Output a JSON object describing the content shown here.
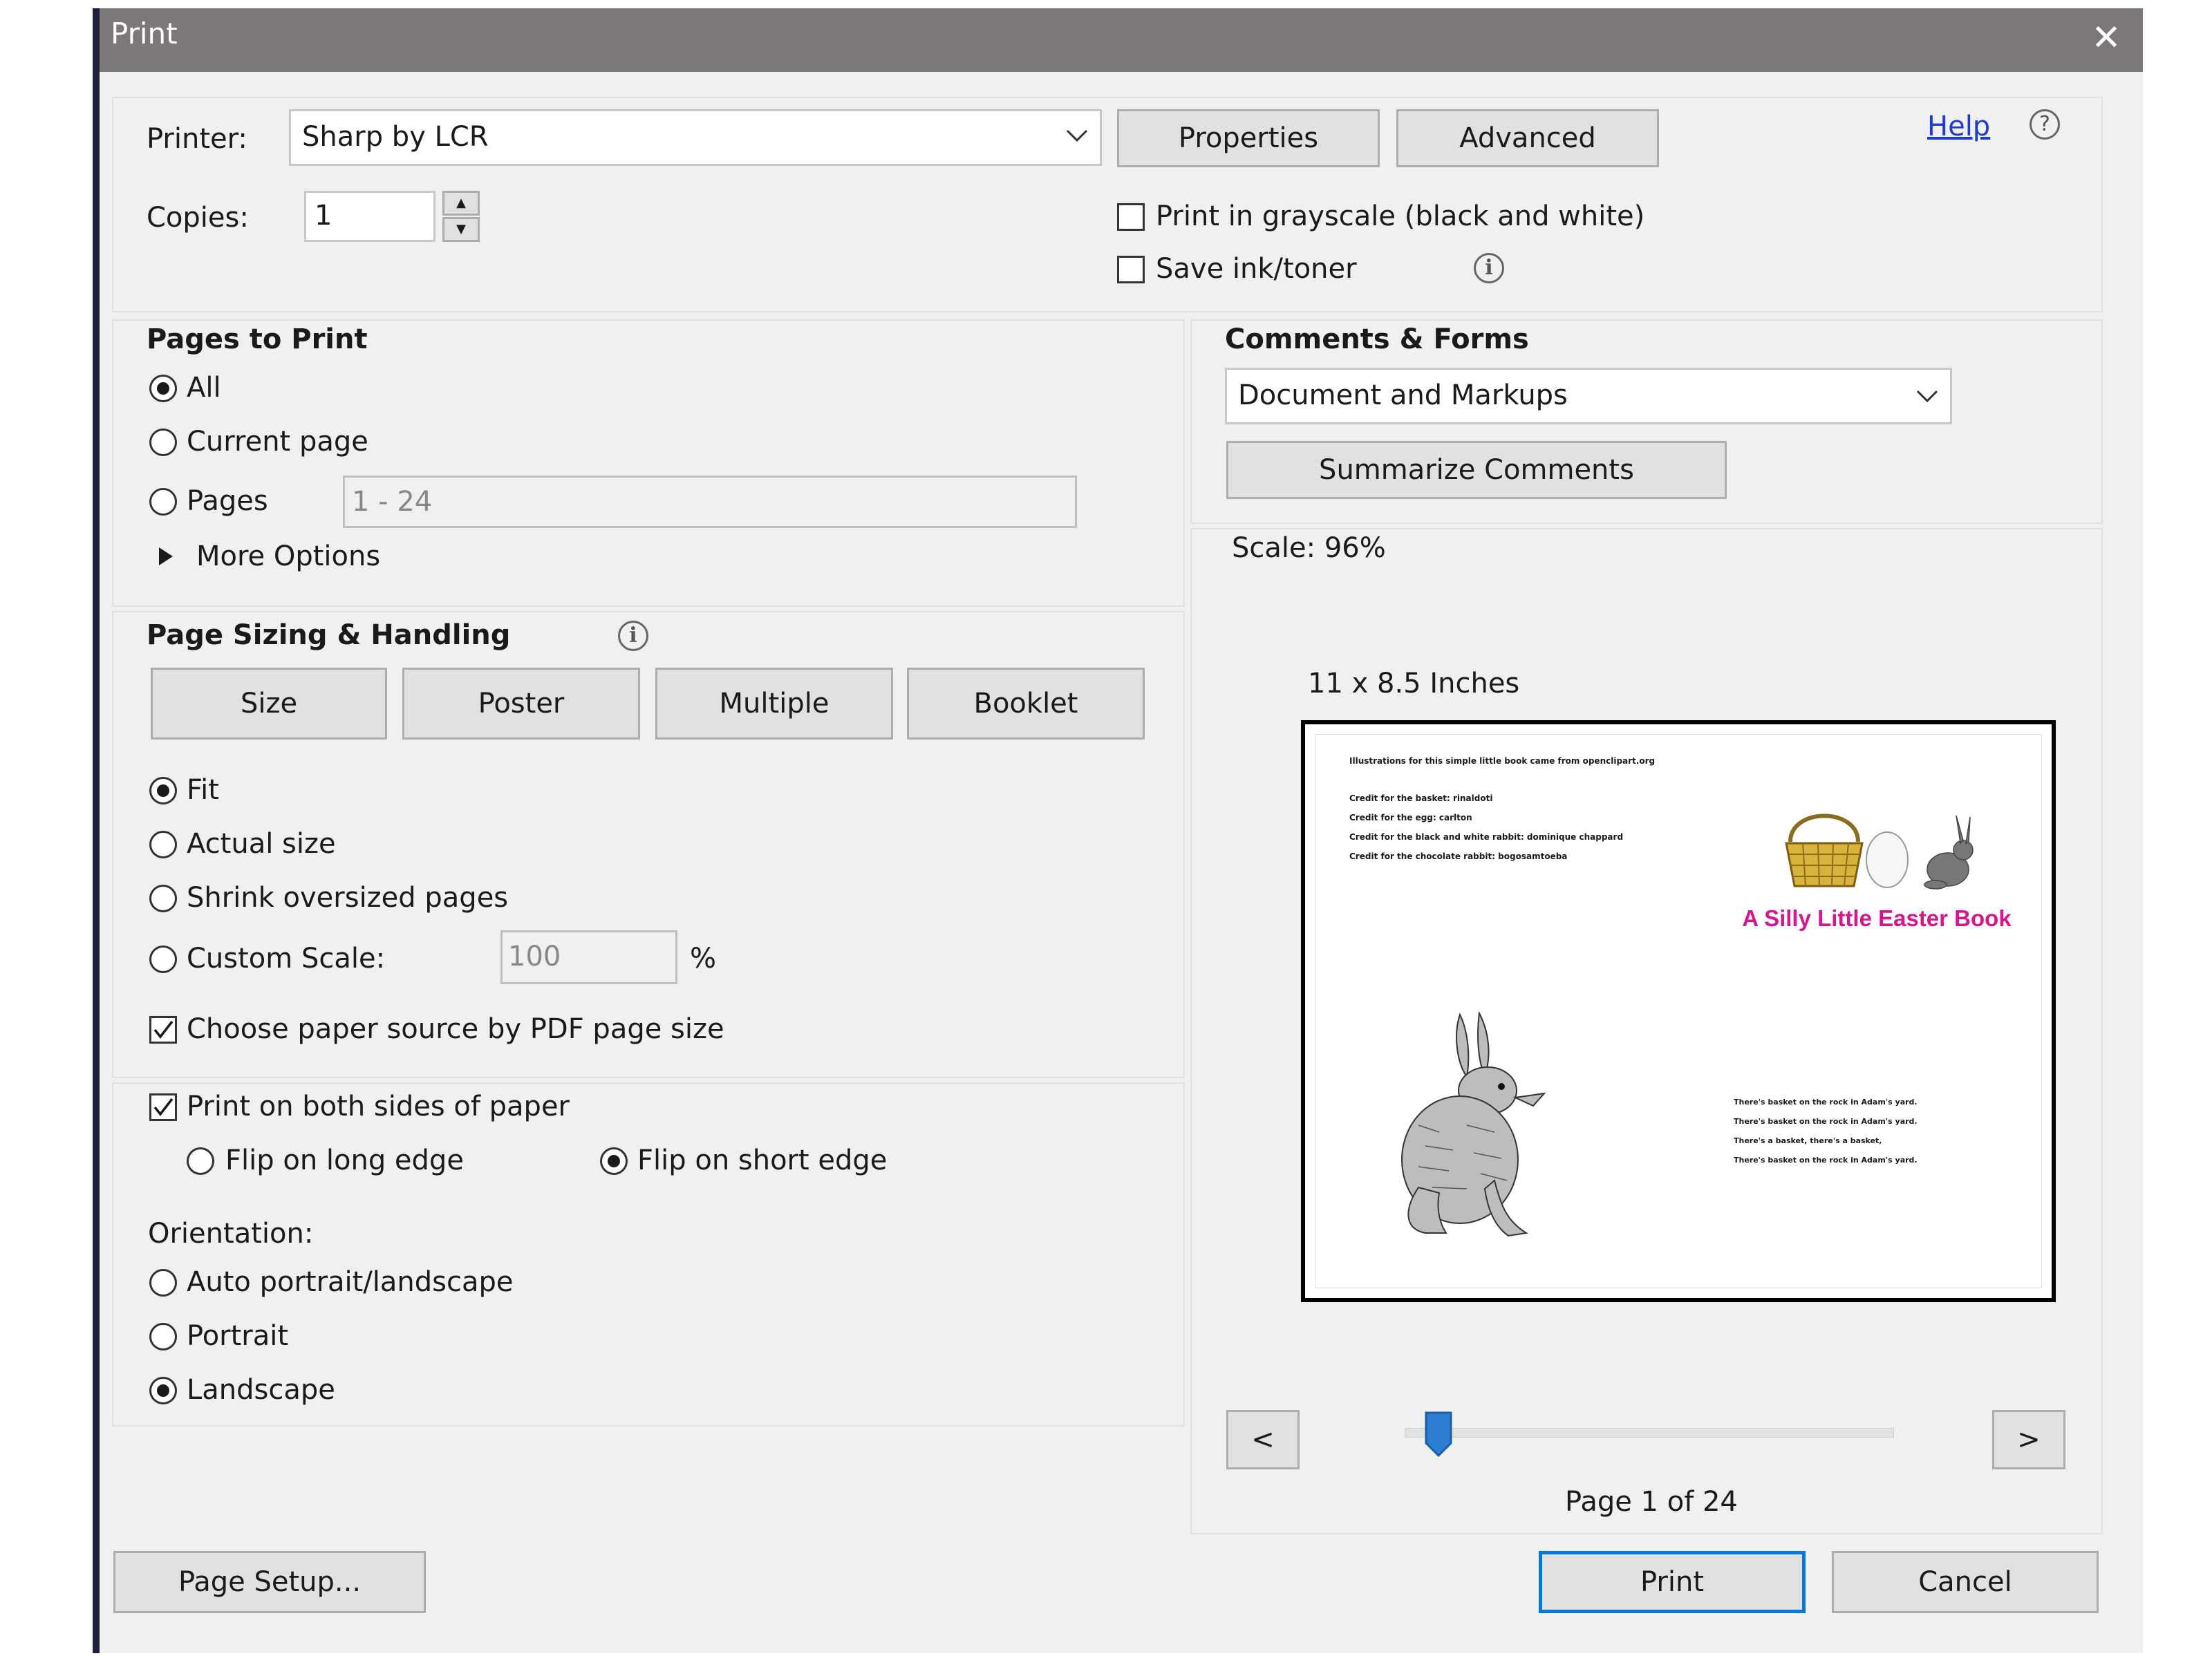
{
  "dialog": {
    "title": "Print",
    "close_label": "✕"
  },
  "printer": {
    "label": "Printer:",
    "selected": "Sharp by LCR",
    "properties": "Properties",
    "advanced": "Advanced",
    "help": "Help",
    "help_icon": "?"
  },
  "copies": {
    "label": "Copies:",
    "value": "1",
    "up": "▲",
    "down": "▼"
  },
  "options": {
    "grayscale": "Print in grayscale (black and white)",
    "save_ink": "Save ink/toner",
    "grayscale_checked": false,
    "save_ink_checked": false
  },
  "pages_to_print": {
    "heading": "Pages to Print",
    "all": "All",
    "current_page": "Current page",
    "pages": "Pages",
    "pages_range": "1 - 24",
    "more_options": "More Options",
    "selected": "all"
  },
  "sizing": {
    "heading": "Page Sizing & Handling",
    "tabs": [
      "Size",
      "Poster",
      "Multiple",
      "Booklet"
    ],
    "fit": "Fit",
    "actual_size": "Actual size",
    "shrink": "Shrink oversized pages",
    "custom_scale": "Custom Scale:",
    "custom_scale_value": "100",
    "percent": "%",
    "paper_source": "Choose paper source by PDF page size",
    "selected": "fit"
  },
  "duplex": {
    "both_sides": "Print on both sides of paper",
    "long_edge": "Flip on long edge",
    "short_edge": "Flip on short edge",
    "selected": "short_edge"
  },
  "orientation": {
    "label": "Orientation:",
    "auto": "Auto portrait/landscape",
    "portrait": "Portrait",
    "landscape": "Landscape",
    "selected": "landscape"
  },
  "comments": {
    "heading": "Comments & Forms",
    "selected": "Document and Markups",
    "summarize": "Summarize Comments"
  },
  "preview": {
    "scale_label": "Scale:",
    "scale_value": "96%",
    "paper_size": "11 x 8.5 Inches",
    "page_text": {
      "credit_heading": "Illustrations for this simple little book came from openclipart.org",
      "credits": [
        "Credit for the basket: rinaldoti",
        "Credit for the egg: carlton",
        "Credit for the black and white rabbit: dominique chappard",
        "Credit for the chocolate rabbit: bogosamtoeba"
      ],
      "book_title": "A Silly Little Easter Book",
      "verse": [
        "There's basket on the rock in Adam's yard.",
        "There's basket on the rock in Adam's yard.",
        "There's a basket, there's a basket,",
        "There's basket on the rock in Adam's yard."
      ],
      "title_color": "#d6168f"
    },
    "prev": "<",
    "next": ">",
    "page_indicator": "Page 1 of 24",
    "page_position": 0.04
  },
  "footer": {
    "page_setup": "Page Setup...",
    "print": "Print",
    "cancel": "Cancel"
  },
  "colors": {
    "accent": "#0078d7",
    "slider": "#2d7dd2"
  }
}
